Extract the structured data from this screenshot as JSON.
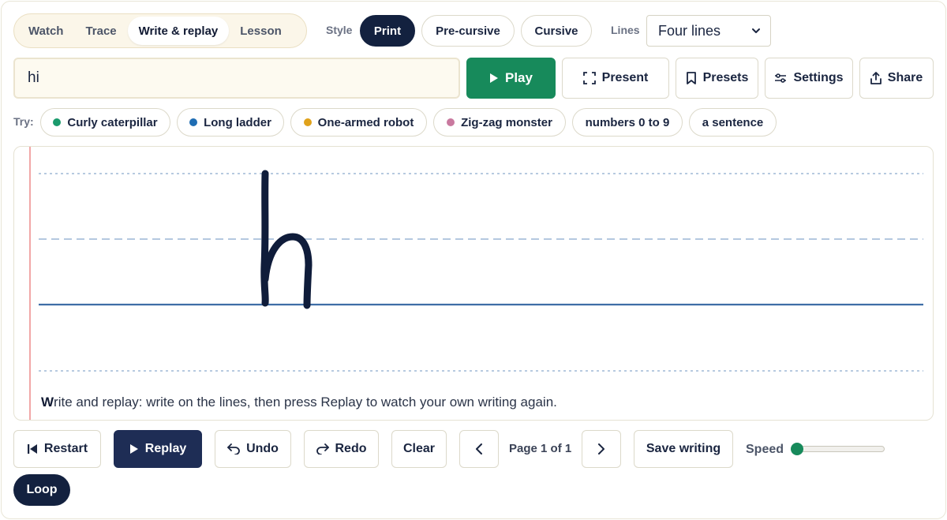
{
  "modes": [
    {
      "label": "Watch",
      "active": false
    },
    {
      "label": "Trace",
      "active": false
    },
    {
      "label": "Write & replay",
      "active": true
    },
    {
      "label": "Lesson",
      "active": false
    }
  ],
  "style": {
    "label": "Style",
    "options": [
      {
        "label": "Print",
        "active": true
      },
      {
        "label": "Pre-cursive",
        "active": false
      },
      {
        "label": "Cursive",
        "active": false
      }
    ]
  },
  "lines": {
    "label": "Lines",
    "selected": "Four lines"
  },
  "text_input": {
    "value": "hi"
  },
  "toolbar": {
    "play": "Play",
    "present": "Present",
    "presets": "Presets",
    "settings": "Settings",
    "share": "Share"
  },
  "try": {
    "label": "Try:",
    "chips": [
      {
        "label": "Curly caterpillar",
        "color": "#1a9a6c"
      },
      {
        "label": "Long ladder",
        "color": "#1f6db3"
      },
      {
        "label": "One-armed robot",
        "color": "#e0a21b"
      },
      {
        "label": "Zig-zag monster",
        "color": "#c9799f"
      },
      {
        "label": "numbers 0 to 9",
        "color": ""
      },
      {
        "label": "a sentence",
        "color": ""
      }
    ]
  },
  "canvas": {
    "hint_first": "W",
    "hint_rest": "rite and replay: write on the lines, then press Replay to watch your own writing again.",
    "ink_color": "#0f1c3a"
  },
  "bottom": {
    "restart": "Restart",
    "replay": "Replay",
    "undo": "Undo",
    "redo": "Redo",
    "clear": "Clear",
    "page_info": "Page 1 of 1",
    "save": "Save writing",
    "speed_label": "Speed",
    "speed_value": 0,
    "loop": "Loop"
  },
  "colors": {
    "accent_green": "#178a5b",
    "navy": "#13213f"
  }
}
